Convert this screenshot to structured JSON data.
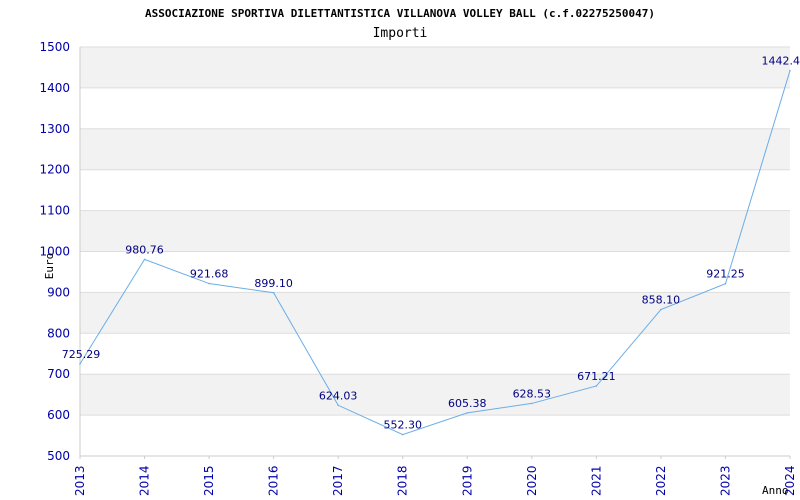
{
  "chart_data": {
    "type": "line",
    "title": "ASSOCIAZIONE SPORTIVA DILETTANTISTICA VILLANOVA VOLLEY BALL (c.f.02275250047)",
    "subtitle": "Importi",
    "xlabel": "Anno",
    "ylabel": "Euro",
    "categories": [
      "2013",
      "2014",
      "2015",
      "2016",
      "2017",
      "2018",
      "2019",
      "2020",
      "2021",
      "2022",
      "2023",
      "2024"
    ],
    "values": [
      725.29,
      980.76,
      921.68,
      899.1,
      624.03,
      552.3,
      605.38,
      628.53,
      671.21,
      858.1,
      921.25,
      1442.4
    ],
    "labels": [
      "725.29",
      "980.76",
      "921.68",
      "899.10",
      "624.03",
      "552.30",
      "605.38",
      "628.53",
      "671.21",
      "858.10",
      "921.25",
      "1442.4"
    ],
    "ylim": [
      500,
      1500
    ],
    "yticks": [
      500,
      600,
      700,
      800,
      900,
      1000,
      1100,
      1200,
      1300,
      1400,
      1500
    ],
    "grid": true,
    "line_color": "#6aaee8",
    "band_color": "#f2f2f2",
    "tick_color": "#0000aa"
  }
}
